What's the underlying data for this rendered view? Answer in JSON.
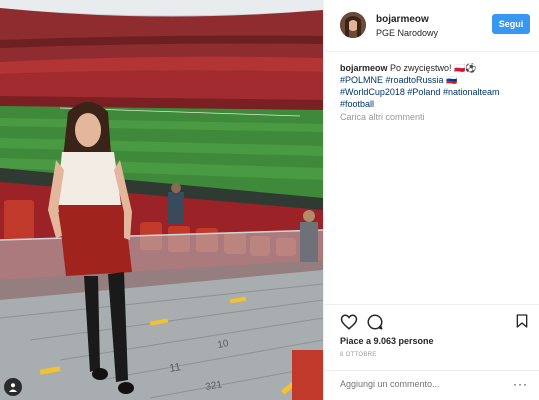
{
  "post": {
    "username": "bojarmeow",
    "location": "PGE Narodowy",
    "follow_label": "Segui",
    "caption_user": "bojarmeow",
    "caption_text": "Po zwycięstwo! 🇵🇱⚽",
    "hashtags_line1": [
      "#POLMNE",
      "#roadtoRussia"
    ],
    "flag_ru": "🇷🇺",
    "hashtags_line2": [
      "#WorldCup2018",
      "#Poland",
      "#nationalteam"
    ],
    "hashtags_line3": [
      "#football"
    ],
    "load_more": "Carica altri commenti",
    "likes": "Piace a 9.063 persone",
    "date": "8 OTTOBRE",
    "comment_placeholder": "Aggiungi un commento...",
    "more_options": "···"
  },
  "photo": {
    "seat_numbers": [
      "10",
      "11",
      "321"
    ]
  },
  "icons": {
    "heart": "heart-icon",
    "comment": "comment-icon",
    "bookmark": "bookmark-icon",
    "user_tag": "person-icon"
  },
  "colors": {
    "follow_button": "#3897f0",
    "hashtag": "#003569",
    "muted": "#999999"
  }
}
